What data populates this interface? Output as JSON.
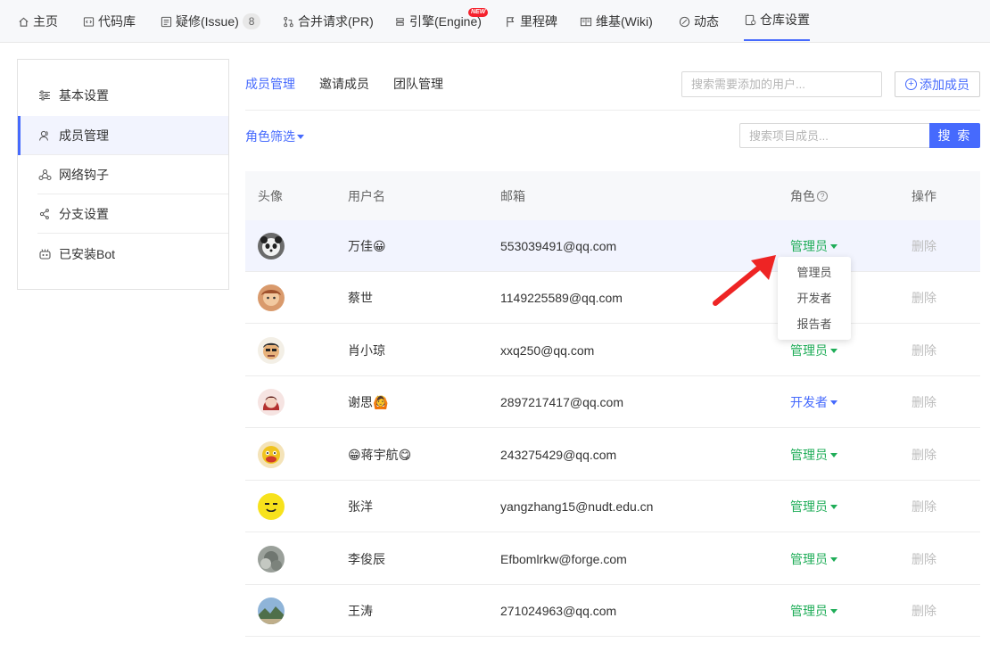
{
  "colors": {
    "accent": "#466afd",
    "admin": "#1fad58",
    "developer": "#466afd",
    "delete": "#bdbdbd",
    "arrow": "#ee2424"
  },
  "topnav": {
    "tabs": [
      {
        "label": "主页",
        "icon": "home-icon"
      },
      {
        "label": "代码库",
        "icon": "code-icon"
      },
      {
        "label": "疑修(Issue)",
        "icon": "issue-icon",
        "count": "8"
      },
      {
        "label": "合并请求(PR)",
        "icon": "pull-request-icon"
      },
      {
        "label": "引擎(Engine)",
        "icon": "engine-icon",
        "badge": "NEW"
      },
      {
        "label": "里程碑",
        "icon": "milestone-flag-icon"
      },
      {
        "label": "维基(Wiki)",
        "icon": "wiki-icon"
      },
      {
        "label": "动态",
        "icon": "activity-icon"
      },
      {
        "label": "仓库设置",
        "icon": "repo-settings-icon",
        "active": true
      }
    ]
  },
  "sidebar": {
    "items": [
      {
        "label": "基本设置",
        "icon": "sliders-icon"
      },
      {
        "label": "成员管理",
        "icon": "members-icon",
        "active": true
      },
      {
        "label": "网络钩子",
        "icon": "webhook-icon"
      },
      {
        "label": "分支设置",
        "icon": "branch-icon"
      },
      {
        "label": "已安装Bot",
        "icon": "bot-icon"
      }
    ]
  },
  "main": {
    "subtabs": [
      {
        "label": "成员管理",
        "active": true
      },
      {
        "label": "邀请成员"
      },
      {
        "label": "团队管理"
      }
    ],
    "add_search_placeholder": "搜索需要添加的用户...",
    "add_button": "添加成员",
    "role_filter": "角色筛选",
    "member_search_placeholder": "搜索项目成员...",
    "search_button": "搜 索"
  },
  "table": {
    "columns": [
      "头像",
      "用户名",
      "邮箱",
      "角色",
      "操作"
    ],
    "rows": [
      {
        "username": "万佳😀",
        "email": "553039491@qq.com",
        "role": "管理员",
        "action": "删除",
        "avatar": "panda-avatar"
      },
      {
        "username": "蔡世",
        "email": "1149225589@qq.com",
        "role": "",
        "action": "删除",
        "avatar": "cartoon-avatar"
      },
      {
        "username": "肖小琼",
        "email": "xxq250@qq.com",
        "role": "管理员",
        "action": "删除",
        "avatar": "cartoon-avatar"
      },
      {
        "username": "谢思🙆",
        "email": "2897217417@qq.com",
        "role": "开发者",
        "action": "删除",
        "avatar": "girl-avatar"
      },
      {
        "username": "😁蒋宇航😋",
        "email": "243275429@qq.com",
        "role": "管理员",
        "action": "删除",
        "avatar": "cartoon-avatar"
      },
      {
        "username": "张洋",
        "email": "yangzhang15@nudt.edu.cn",
        "role": "管理员",
        "action": "删除",
        "avatar": "emoji-avatar"
      },
      {
        "username": "李俊辰",
        "email": "Efbomlrkw@forge.com",
        "role": "管理员",
        "action": "删除",
        "avatar": "photo-avatar"
      },
      {
        "username": "王涛",
        "email": "271024963@qq.com",
        "role": "管理员",
        "action": "删除",
        "avatar": "landscape-avatar"
      }
    ]
  },
  "role_dropdown": {
    "options": [
      "管理员",
      "开发者",
      "报告者"
    ]
  }
}
